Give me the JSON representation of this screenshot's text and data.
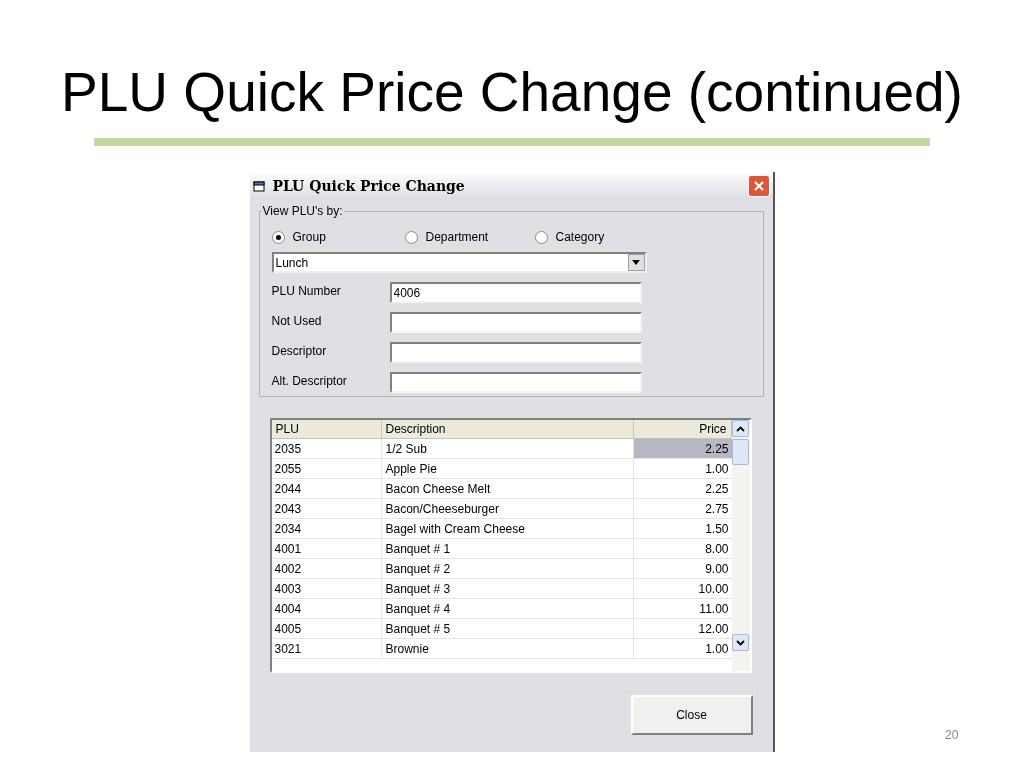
{
  "slide": {
    "title": "PLU Quick Price Change (continued)",
    "page_number": "20"
  },
  "window": {
    "title": "PLU Quick Price Change"
  },
  "view_by": {
    "legend": "View PLU's by:",
    "options": [
      {
        "label": "Group",
        "selected": true
      },
      {
        "label": "Department",
        "selected": false
      },
      {
        "label": "Category",
        "selected": false
      }
    ],
    "dropdown": {
      "value": "Lunch"
    }
  },
  "fields": [
    {
      "label": "PLU Number",
      "value": "4006"
    },
    {
      "label": "Not Used"
    },
    {
      "label": "Descriptor"
    },
    {
      "label": "Alt. Descriptor"
    }
  ],
  "table": {
    "columns": [
      "PLU",
      "Description",
      "Price"
    ],
    "rows": [
      {
        "plu": "2035",
        "description": "1/2 Sub",
        "price": "2.25",
        "selected": true
      },
      {
        "plu": "2055",
        "description": "Apple Pie",
        "price": "1.00",
        "selected": false
      },
      {
        "plu": "2044",
        "description": "Bacon Cheese Melt",
        "price": "2.25",
        "selected": false
      },
      {
        "plu": "2043",
        "description": "Bacon/Cheeseburger",
        "price": "2.75",
        "selected": false
      },
      {
        "plu": "2034",
        "description": "Bagel with Cream Cheese",
        "price": "1.50",
        "selected": false
      },
      {
        "plu": "4001",
        "description": "Banquet # 1",
        "price": "8.00",
        "selected": false
      },
      {
        "plu": "4002",
        "description": "Banquet # 2",
        "price": "9.00",
        "selected": false
      },
      {
        "plu": "4003",
        "description": "Banquet # 3",
        "price": "10.00",
        "selected": false
      },
      {
        "plu": "4004",
        "description": "Banquet # 4",
        "price": "11.00",
        "selected": false
      },
      {
        "plu": "4005",
        "description": "Banquet # 5",
        "price": "12.00",
        "selected": false
      },
      {
        "plu": "3021",
        "description": "Brownie",
        "price": "1.00",
        "selected": false
      }
    ]
  },
  "buttons": [
    "Close"
  ]
}
